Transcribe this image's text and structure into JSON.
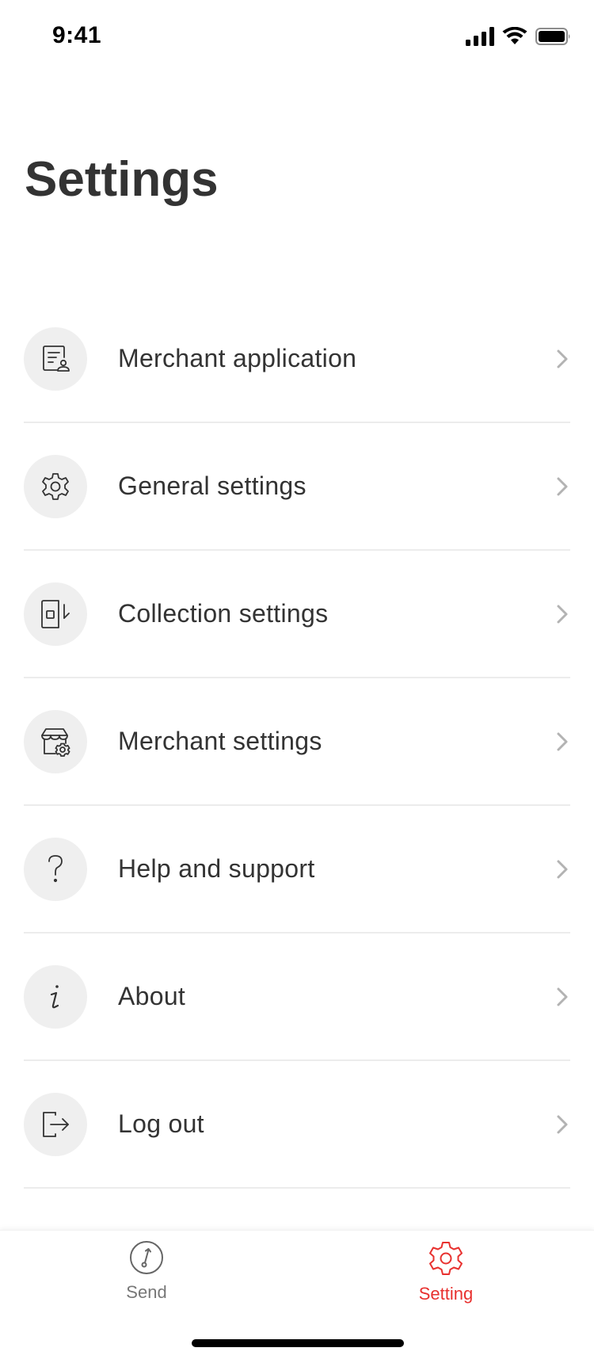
{
  "status_bar": {
    "time": "9:41",
    "icons": [
      "signal-icon",
      "wifi-icon",
      "battery-icon"
    ]
  },
  "page": {
    "title": "Settings"
  },
  "settings_items": [
    {
      "label": "Merchant application",
      "icon": "application-form-icon"
    },
    {
      "label": "General settings",
      "icon": "gear-icon"
    },
    {
      "label": "Collection settings",
      "icon": "collection-icon"
    },
    {
      "label": "Merchant settings",
      "icon": "store-settings-icon"
    },
    {
      "label": "Help and support",
      "icon": "question-icon"
    },
    {
      "label": "About",
      "icon": "info-icon"
    },
    {
      "label": "Log out",
      "icon": "logout-icon"
    }
  ],
  "tab_bar": {
    "tabs": [
      {
        "label": "Send",
        "icon": "send-icon",
        "active": false
      },
      {
        "label": "Setting",
        "icon": "setting-gear-icon",
        "active": true
      }
    ]
  },
  "colors": {
    "accent": "#e8312f",
    "text": "#333333",
    "inactive_tab": "#777777",
    "icon_bg": "#efefef",
    "divider": "#ececec",
    "chevron": "#b3b3b3"
  }
}
